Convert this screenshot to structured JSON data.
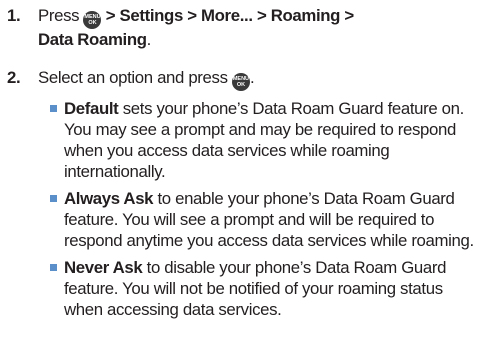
{
  "steps": [
    {
      "number": "1.",
      "parts": {
        "press": "Press",
        "path1": "> Settings > More... > Roaming >",
        "path2": "Data Roaming",
        "end": "."
      }
    },
    {
      "number": "2.",
      "parts": {
        "text": "Select an option and press",
        "end": "."
      }
    }
  ],
  "menu_key": {
    "icon": "menu-ok-key-icon",
    "line1": "MENU",
    "line2": "OK"
  },
  "options": [
    {
      "title": "Default",
      "lines": [
        " sets your phone’s Data Roam Guard feature on.",
        "You may see a prompt and may be required to respond",
        "when you access data services while roaming",
        "internationally."
      ]
    },
    {
      "title": "Always Ask",
      "lines": [
        " to enable your phone’s Data Roam Guard",
        "feature. You will see a prompt and will be required to",
        "respond anytime you access data services while roaming."
      ]
    },
    {
      "title": "Never Ask",
      "lines": [
        " to disable your phone’s Data Roam Guard",
        "feature. You will not be notified of your roaming status",
        "when accessing data services."
      ]
    }
  ],
  "colors": {
    "text": "#231f20",
    "bullet": "#5a8fc9",
    "key": "#3a3a3a"
  }
}
